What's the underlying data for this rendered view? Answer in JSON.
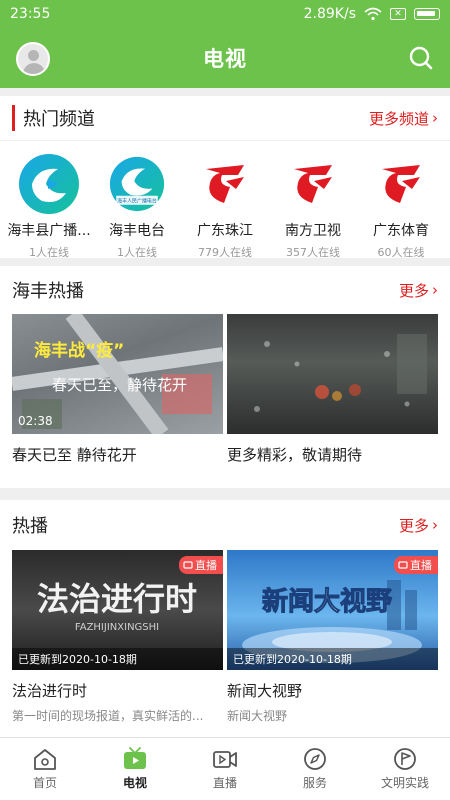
{
  "status_bar": {
    "time": "23:55",
    "network_speed": "2.89K/s"
  },
  "header": {
    "title": "电视"
  },
  "hot_channels": {
    "title": "热门频道",
    "more_label": "更多频道",
    "channels": [
      {
        "name": "海丰县广播...",
        "online": "1人在线",
        "logo": "haifeng-logo"
      },
      {
        "name": "海丰电台",
        "online": "1人在线",
        "logo": "haifeng-radio-logo",
        "logo_text": "海丰人民广播电台"
      },
      {
        "name": "广东珠江",
        "online": "779人在线",
        "logo": "guangdong-tv-logo"
      },
      {
        "name": "南方卫视",
        "online": "357人在线",
        "logo": "guangdong-tv-logo"
      },
      {
        "name": "广东体育",
        "online": "60人在线",
        "logo": "guangdong-tv-logo"
      }
    ]
  },
  "haifeng_hot": {
    "title": "海丰热播",
    "more_label": "更多",
    "items": [
      {
        "caption": "春天已至 静待花开",
        "duration": "02:38",
        "overlay_line1": "海丰战“疫”",
        "overlay_line2": "春天已至，静待花开"
      },
      {
        "caption": "更多精彩，敬请期待"
      }
    ]
  },
  "hot": {
    "title": "热播",
    "more_label": "更多",
    "items": [
      {
        "caption": "法治进行时",
        "subtitle": "第一时间的现场报道，真实鲜活的...",
        "badge": "直播",
        "updated": "已更新到2020-10-18期",
        "art_title": "法治进行时",
        "art_sub": "FAZHIJINXINGSHI"
      },
      {
        "caption": "新闻大视野",
        "subtitle": "新闻大视野",
        "badge": "直播",
        "updated": "已更新到2020-10-18期",
        "art_title": "新闻大视野"
      }
    ]
  },
  "tabbar": {
    "tabs": [
      {
        "label": "首页",
        "icon": "home-icon"
      },
      {
        "label": "电视",
        "icon": "tv-icon",
        "active": true
      },
      {
        "label": "直播",
        "icon": "video-icon"
      },
      {
        "label": "服务",
        "icon": "compass-icon"
      },
      {
        "label": "文明实践",
        "icon": "flag-badge-icon"
      }
    ]
  },
  "colors": {
    "primary_green": "#6cc24a",
    "accent_red": "#e02020"
  }
}
